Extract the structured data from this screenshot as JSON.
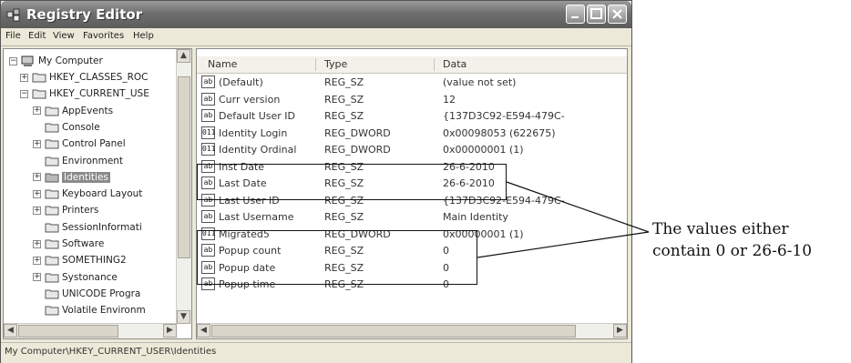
{
  "window": {
    "title": "Registry Editor",
    "menu": [
      "File",
      "Edit",
      "View",
      "Favorites",
      "Help"
    ]
  },
  "tree": {
    "root": "My Computer",
    "items": [
      {
        "label": "HKEY_CLASSES_ROC",
        "level": 1,
        "expander": "+"
      },
      {
        "label": "HKEY_CURRENT_USE",
        "level": 1,
        "expander": "−"
      },
      {
        "label": "AppEvents",
        "level": 2,
        "expander": "+"
      },
      {
        "label": "Console",
        "level": 2,
        "expander": ""
      },
      {
        "label": "Control Panel",
        "level": 2,
        "expander": "+"
      },
      {
        "label": "Environment",
        "level": 2,
        "expander": ""
      },
      {
        "label": "Identities",
        "level": 2,
        "expander": "+",
        "selected": true
      },
      {
        "label": "Keyboard Layout",
        "level": 2,
        "expander": "+"
      },
      {
        "label": "Printers",
        "level": 2,
        "expander": "+"
      },
      {
        "label": "SessionInformati",
        "level": 2,
        "expander": ""
      },
      {
        "label": "Software",
        "level": 2,
        "expander": "+"
      },
      {
        "label": "SOMETHING2",
        "level": 2,
        "expander": "+"
      },
      {
        "label": "Systonance",
        "level": 2,
        "expander": "+"
      },
      {
        "label": "UNICODE Progra",
        "level": 2,
        "expander": ""
      },
      {
        "label": "Volatile Environm",
        "level": 2,
        "expander": ""
      }
    ]
  },
  "list": {
    "columns": [
      "Name",
      "Type",
      "Data"
    ],
    "rows": [
      {
        "icon": "ab",
        "name": "(Default)",
        "type": "REG_SZ",
        "data": "(value not set)"
      },
      {
        "icon": "ab",
        "name": "Curr version",
        "type": "REG_SZ",
        "data": "12"
      },
      {
        "icon": "ab",
        "name": "Default User ID",
        "type": "REG_SZ",
        "data": "{137D3C92-E594-479C-"
      },
      {
        "icon": "dw",
        "name": "Identity Login",
        "type": "REG_DWORD",
        "data": "0x00098053 (622675)"
      },
      {
        "icon": "dw",
        "name": "Identity Ordinal",
        "type": "REG_DWORD",
        "data": "0x00000001 (1)"
      },
      {
        "icon": "ab",
        "name": "Inst Date",
        "type": "REG_SZ",
        "data": "26-6-2010"
      },
      {
        "icon": "ab",
        "name": "Last Date",
        "type": "REG_SZ",
        "data": "26-6-2010"
      },
      {
        "icon": "ab",
        "name": "Last User ID",
        "type": "REG_SZ",
        "data": "{137D3C92-E594-479C-"
      },
      {
        "icon": "ab",
        "name": "Last Username",
        "type": "REG_SZ",
        "data": "Main Identity"
      },
      {
        "icon": "dw",
        "name": "Migrated5",
        "type": "REG_DWORD",
        "data": "0x00000001 (1)"
      },
      {
        "icon": "ab",
        "name": "Popup count",
        "type": "REG_SZ",
        "data": "0"
      },
      {
        "icon": "ab",
        "name": "Popup date",
        "type": "REG_SZ",
        "data": "0"
      },
      {
        "icon": "ab",
        "name": "Popup time",
        "type": "REG_SZ",
        "data": "0"
      }
    ]
  },
  "status": "My Computer\\HKEY_CURRENT_USER\\Identities",
  "annotation": {
    "line1": "The values either",
    "line2": "contain 0 or 26-6-10"
  }
}
